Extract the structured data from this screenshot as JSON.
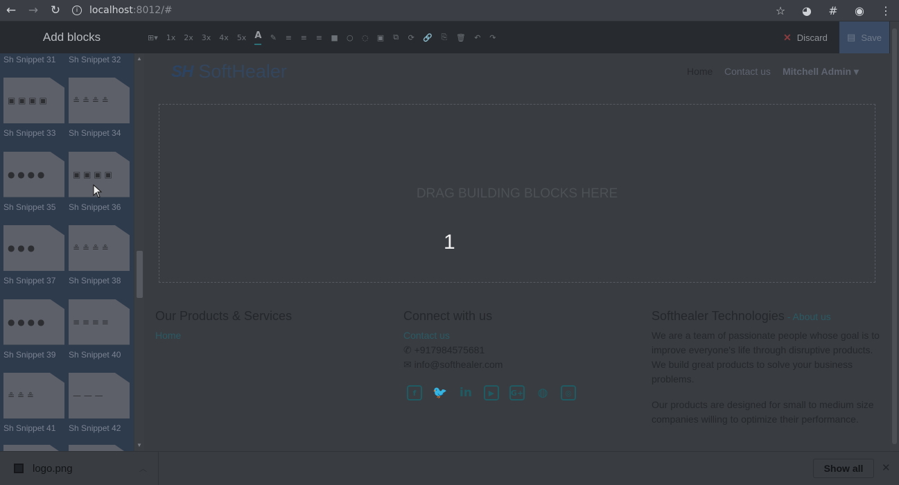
{
  "browser": {
    "url_host": "localhost",
    "url_rest": ":8012/#",
    "back_icon": "arrow-left-icon",
    "forward_icon": "arrow-right-icon",
    "reload_icon": "reload-icon"
  },
  "editor": {
    "add_blocks_label": "Add blocks",
    "tools": [
      "⊞▾",
      "1x",
      "2x",
      "3x",
      "4x",
      "5x",
      "A",
      "✎",
      "≡",
      "≡",
      "≡",
      "■",
      "○",
      "◌",
      "▣",
      "⧉",
      "⟳",
      "🔗",
      "⎘",
      "🗑",
      "↶",
      "↷"
    ],
    "discard_label": "Discard",
    "save_label": "Save"
  },
  "sidebar": {
    "top_labels": [
      "Sh Snippet 31",
      "Sh Snippet 32"
    ],
    "snippets": [
      {
        "label": "Sh Snippet 33",
        "glyph": "▣ ▣ ▣ ▣"
      },
      {
        "label": "Sh Snippet 34",
        "glyph": "≗ ≗ ≗ ≗"
      },
      {
        "label": "Sh Snippet 35",
        "glyph": "● ● ● ●"
      },
      {
        "label": "Sh Snippet 36",
        "glyph": "▣ ▣ ▣ ▣"
      },
      {
        "label": "Sh Snippet 37",
        "glyph": "● ● ●"
      },
      {
        "label": "Sh Snippet 38",
        "glyph": "≗ ≗ ≗ ≗"
      },
      {
        "label": "Sh Snippet 39",
        "glyph": "● ● ● ●"
      },
      {
        "label": "Sh Snippet 40",
        "glyph": "≡ ≡ ≡ ≡"
      },
      {
        "label": "Sh Snippet 41",
        "glyph": "≗ ≗ ≗"
      },
      {
        "label": "Sh Snippet 42",
        "glyph": "— — —"
      }
    ],
    "badge": "SH"
  },
  "site": {
    "logo_mark": "SH",
    "logo_word": "SoftHealer",
    "nav": {
      "home": "Home",
      "contact": "Contact us",
      "admin": "Mitchell Admin ▾"
    },
    "dropzone_text": "DRAG BUILDING BLOCKS HERE",
    "counter": "1",
    "footer": {
      "products_title": "Our Products & Services",
      "products_home": "Home",
      "connect_title": "Connect with us",
      "connect_contact": "Contact us",
      "phone": "+917984575681",
      "email": "info@softhealer.com",
      "about_title": "Softhealer Technologies",
      "about_sep": " - ",
      "about_link": "About us",
      "about_p1": "We are a team of passionate people whose goal is to improve everyone's life through disruptive products. We build great products to solve your business problems.",
      "about_p2": "Our products are designed for small to medium size companies willing to optimize their performance.",
      "social_icons": [
        "facebook-icon",
        "twitter-icon",
        "linkedin-icon",
        "youtube-icon",
        "google-plus-icon",
        "github-icon",
        "instagram-icon"
      ]
    }
  },
  "downloads": {
    "file_name": "logo.png",
    "show_all": "Show all"
  }
}
